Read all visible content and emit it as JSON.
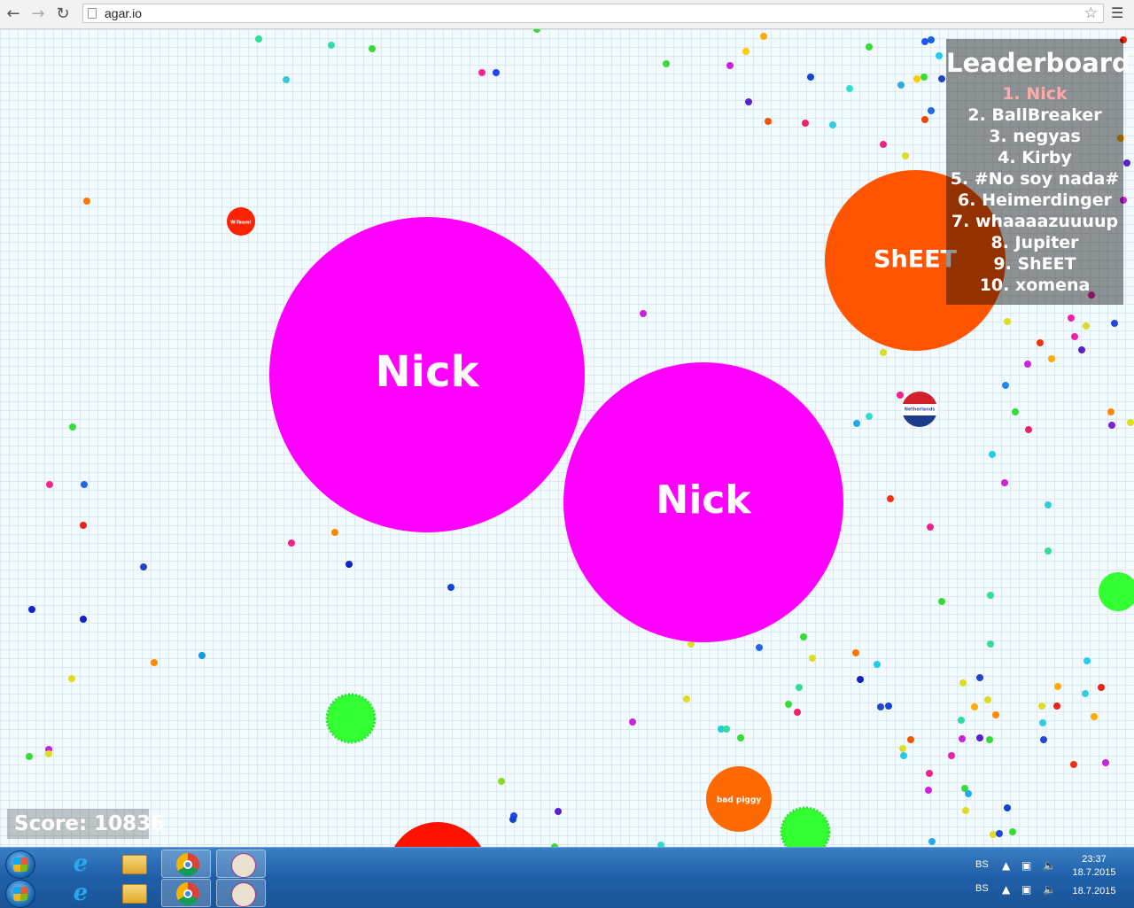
{
  "browser": {
    "url": "agar.io",
    "back_icon": "back-arrow-icon",
    "forward_icon": "forward-arrow-icon",
    "reload_icon": "reload-icon",
    "star_icon": "star-icon",
    "menu_icon": "hamburger-menu-icon"
  },
  "game": {
    "player_cells": [
      {
        "name": "Nick",
        "color": "#ff00ff"
      },
      {
        "name": "Nick",
        "color": "#ff00ff"
      }
    ],
    "other_cells": [
      {
        "name": "ShEET",
        "color": "#ff5500"
      },
      {
        "name": "bad piggy",
        "color": "#ff6a00"
      },
      {
        "name": "W-Team!",
        "color": "#ff2200"
      },
      {
        "name": "Netherlands",
        "color": "#1e3a8a"
      }
    ],
    "virus_color": "#33ff33"
  },
  "leaderboard": {
    "title": "Leaderboard",
    "entries": [
      "1. Nick",
      "2. BallBreaker",
      "3. negyas",
      "4. Kirby",
      "5. #No soy nada#",
      "6. Heimerdinger",
      "7. whaaaazuuuup",
      "8. Jupiter",
      "9. ShEET",
      "10. xomena"
    ],
    "highlight_color": "#ffaaaa"
  },
  "score": {
    "text": "Score: 10836"
  },
  "taskbar": {
    "language": "BS",
    "time": "23:37",
    "date": "18.7.2015",
    "apps": [
      "start-orb",
      "internet-explorer-icon",
      "file-explorer-icon",
      "chrome-icon",
      "paint-icon"
    ]
  }
}
